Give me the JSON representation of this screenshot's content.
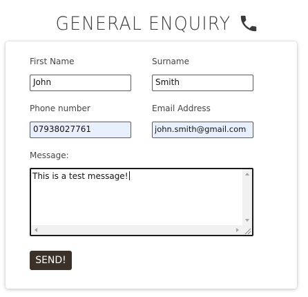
{
  "header": {
    "title": "GENERAL ENQUIRY",
    "icon": "phone-icon"
  },
  "form": {
    "first_name": {
      "label": "First Name",
      "value": "John"
    },
    "surname": {
      "label": "Surname",
      "value": "Smith"
    },
    "phone": {
      "label": "Phone number",
      "value": "07938027761"
    },
    "email": {
      "label": "Email Address",
      "value": "john.smith@gmail.com"
    },
    "message": {
      "label": "Message:",
      "value": "This is a test message!"
    },
    "send_label": "SEND!"
  },
  "colors": {
    "button_bg": "#3b3128",
    "autofill_bg": "#e8f0fe",
    "heading_text": "#3a3a3a"
  }
}
